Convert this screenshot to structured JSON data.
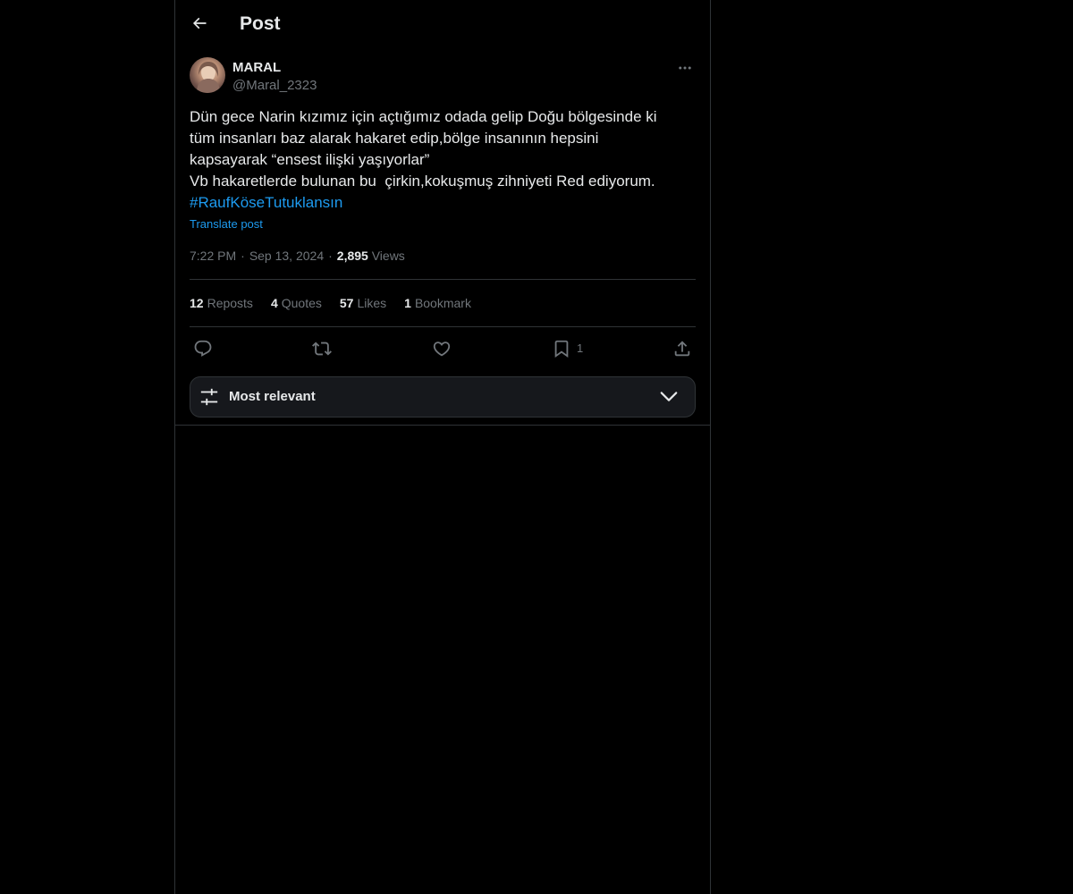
{
  "header": {
    "title": "Post",
    "back_icon": "arrow-left-icon"
  },
  "post": {
    "author": {
      "display_name": "MARAL",
      "handle": "@Maral_2323"
    },
    "text": "Dün gece Narin kızımız için açtığımız odada gelip Doğu bölgesinde ki\ntüm insanları baz alarak hakaret edip,bölge insanının hepsini\nkapsayarak “ensest ilişki yaşıyorlar”\nVb hakaretlerde bulunan bu  çirkin,kokuşmuş zihniyeti Red ediyorum.",
    "hashtag": "#RaufKöseTutuklansın",
    "translate_label": "Translate post",
    "time": "7:22 PM",
    "date": "Sep 13, 2024",
    "views_count": "2,895",
    "views_label": "Views",
    "meta_separator": "·"
  },
  "stats": {
    "reposts": {
      "count": "12",
      "label": "Reposts"
    },
    "quotes": {
      "count": "4",
      "label": "Quotes"
    },
    "likes": {
      "count": "57",
      "label": "Likes"
    },
    "bookmarks": {
      "count": "1",
      "label": "Bookmark"
    }
  },
  "actions": {
    "reply_icon": "reply-icon",
    "repost_icon": "repost-icon",
    "like_icon": "heart-icon",
    "bookmark_icon": "bookmark-icon",
    "bookmark_count": "1",
    "share_icon": "share-icon"
  },
  "sort": {
    "label": "Most relevant",
    "icon": "sliders-icon",
    "chevron": "chevron-down-icon"
  },
  "colors": {
    "background": "#000000",
    "text": "#e7e9ea",
    "muted": "#71767b",
    "link": "#1d9bf0",
    "border": "#2f3336",
    "sort_bg": "#16181c"
  }
}
